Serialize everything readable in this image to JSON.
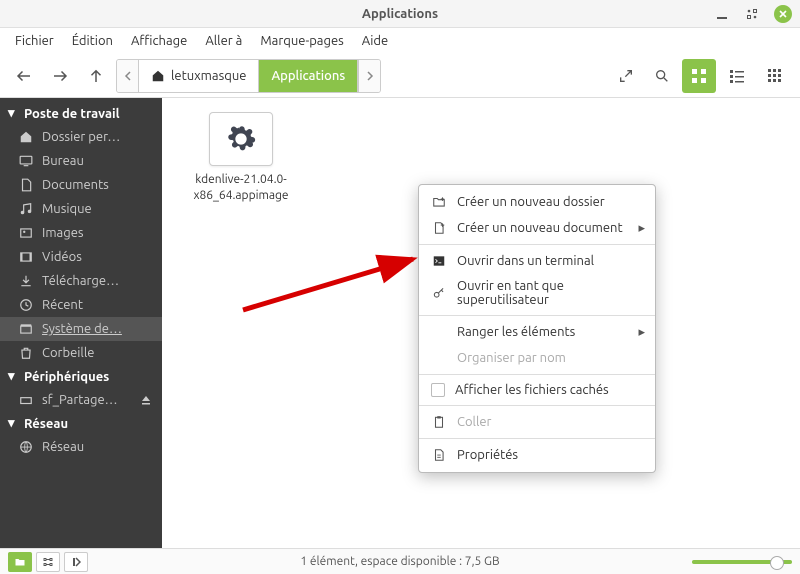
{
  "window": {
    "title": "Applications"
  },
  "menubar": [
    "Fichier",
    "Édition",
    "Affichage",
    "Aller à",
    "Marque-pages",
    "Aide"
  ],
  "path": {
    "segments": [
      {
        "label": "letuxmasque",
        "icon": "home"
      },
      {
        "label": "Applications",
        "active": true
      }
    ]
  },
  "sidebar": {
    "sections": [
      {
        "header": "Poste de travail",
        "items": [
          {
            "icon": "home",
            "label": "Dossier per…"
          },
          {
            "icon": "desktop",
            "label": "Bureau"
          },
          {
            "icon": "doc",
            "label": "Documents"
          },
          {
            "icon": "music",
            "label": "Musique"
          },
          {
            "icon": "image",
            "label": "Images"
          },
          {
            "icon": "video",
            "label": "Vidéos"
          },
          {
            "icon": "download",
            "label": "Télécharge…"
          },
          {
            "icon": "recent",
            "label": "Récent"
          },
          {
            "icon": "system",
            "label": "Système de…",
            "selected": true,
            "underline": true
          },
          {
            "icon": "trash",
            "label": "Corbeille"
          }
        ]
      },
      {
        "header": "Périphériques",
        "items": [
          {
            "icon": "drive",
            "label": "sf_Partage…",
            "eject": true
          }
        ]
      },
      {
        "header": "Réseau",
        "items": [
          {
            "icon": "network",
            "label": "Réseau"
          }
        ]
      }
    ]
  },
  "files": [
    {
      "name": "kdenlive-21.04.0-x86_64.appimage",
      "icon": "gear"
    }
  ],
  "context_menu": {
    "groups": [
      [
        {
          "icon": "folder-plus",
          "label": "Créer un nouveau dossier"
        },
        {
          "icon": "doc-plus",
          "label": "Créer un nouveau document",
          "submenu": true
        }
      ],
      [
        {
          "icon": "terminal",
          "label": "Ouvrir dans un terminal"
        },
        {
          "icon": "key",
          "label": "Ouvrir en tant que superutilisateur"
        }
      ],
      [
        {
          "icon": "",
          "label": "Ranger les éléments",
          "submenu": true,
          "indent": true
        },
        {
          "icon": "",
          "label": "Organiser par nom",
          "disabled": true,
          "indent": true
        }
      ],
      [
        {
          "icon": "checkbox",
          "label": "Afficher les fichiers cachés"
        }
      ],
      [
        {
          "icon": "paste",
          "label": "Coller",
          "disabled": true
        }
      ],
      [
        {
          "icon": "props",
          "label": "Propriétés"
        }
      ]
    ]
  },
  "statusbar": {
    "text": "1 élément, espace disponible : 7,5 GB"
  }
}
